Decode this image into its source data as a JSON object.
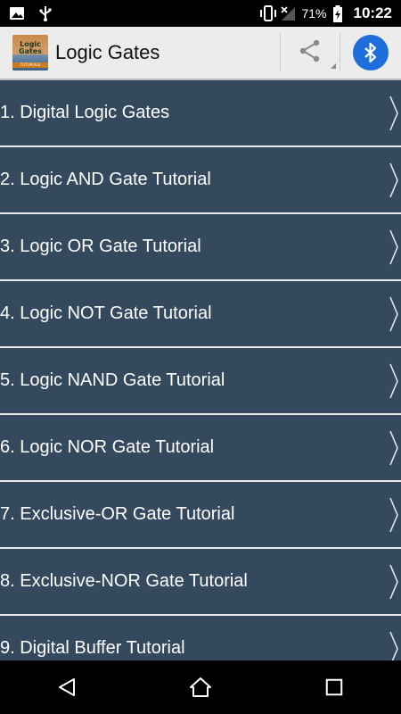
{
  "status_bar": {
    "battery_percent": "71%",
    "time": "10:22"
  },
  "app_bar": {
    "title": "Logic Gates",
    "logo_text": "Logic Gates",
    "logo_sub": "TUTORIALS"
  },
  "list": {
    "items": [
      {
        "label": "1. Digital Logic Gates"
      },
      {
        "label": "2. Logic AND Gate Tutorial"
      },
      {
        "label": "3. Logic OR Gate Tutorial"
      },
      {
        "label": "4. Logic NOT Gate Tutorial"
      },
      {
        "label": "5. Logic NAND Gate Tutorial"
      },
      {
        "label": "6. Logic NOR Gate Tutorial"
      },
      {
        "label": "7. Exclusive-OR Gate Tutorial"
      },
      {
        "label": "8. Exclusive-NOR Gate Tutorial"
      },
      {
        "label": "9. Digital Buffer Tutorial"
      }
    ]
  },
  "colors": {
    "list_item_bg": "#34495e",
    "app_bar_bg": "#ececec",
    "bluetooth_blue": "#1e6fd9"
  },
  "icons": {
    "status_left": [
      "image-icon",
      "usb-icon"
    ],
    "status_right": [
      "vibrate-icon",
      "no-signal-icon",
      "battery-charging-icon"
    ],
    "app_bar": [
      "share-icon",
      "bluetooth-icon"
    ],
    "nav": [
      "back-icon",
      "home-icon",
      "recents-icon"
    ]
  }
}
